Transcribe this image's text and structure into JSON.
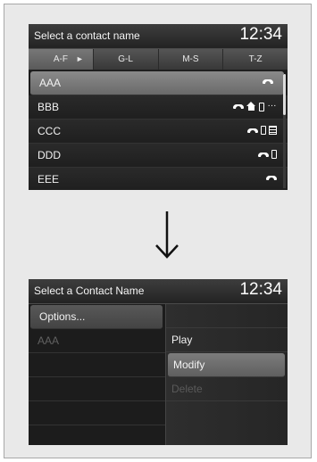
{
  "screen1": {
    "title": "Select a contact name",
    "clock": "12:34",
    "tabs": [
      {
        "label": "A-F",
        "active": true,
        "arrow": "►"
      },
      {
        "label": "G-L"
      },
      {
        "label": "M-S"
      },
      {
        "label": "T-Z"
      }
    ],
    "rows": [
      {
        "name": "AAA",
        "icons": [
          "phone-icon"
        ]
      },
      {
        "name": "BBB",
        "icons": [
          "phone-icon",
          "home-icon",
          "mobile-icon",
          "more-icon"
        ]
      },
      {
        "name": "CCC",
        "icons": [
          "phone-icon",
          "mobile-icon",
          "office-icon"
        ]
      },
      {
        "name": "DDD",
        "icons": [
          "phone-icon",
          "mobile-icon"
        ]
      },
      {
        "name": "EEE",
        "icons": [
          "phone-icon"
        ]
      }
    ],
    "more_glyph": "···"
  },
  "arrow": "down-arrow-icon",
  "screen2": {
    "title": "Select a Contact Name",
    "clock": "12:34",
    "options_label": "Options...",
    "contact": "AAA",
    "menu": [
      {
        "label": "Play",
        "state": "normal"
      },
      {
        "label": "Modify",
        "state": "selected"
      },
      {
        "label": "Delete",
        "state": "disabled"
      }
    ]
  },
  "colors": {
    "page_bg": "#e9e9e9",
    "screen_bg": "#1b1b1b",
    "highlight": "#7c7c7c"
  }
}
